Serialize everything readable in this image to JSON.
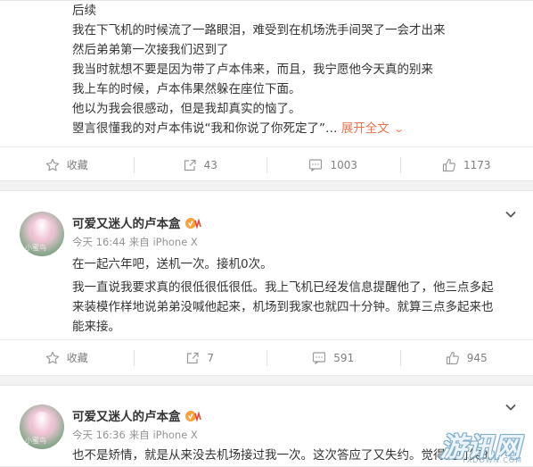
{
  "posts": [
    {
      "lines": [
        "后续",
        "我在下飞机的时候流了一路眼泪，难受到在机场洗手间哭了一会才出来",
        "然后弟弟第一次接我们迟到了",
        "我当时就想不要是因为带了卢本伟来，而且，我宁愿他今天真的别来",
        "我上车的时候，卢本伟果然躲在座位下面。",
        "他以为我会很感动，但是我却真实的恼了。",
        "曌言很懂我的对卢本伟说“我和你说了你死定了”…"
      ],
      "expand_label": "展开全文",
      "actions": {
        "favorite": "收藏",
        "repost": "43",
        "comment": "1003",
        "like": "1173"
      }
    },
    {
      "username": "可爱又迷人的卢本盒",
      "time": "今天 16:44",
      "source": "来自 iPhone X",
      "lines": [
        "在一起六年吧，送机一次。接机0次。",
        "我一直说我要求真的很低很低很低。我上飞机已经发信息提醒他了，他三点多起",
        "来装模作样地说弟弟没喊他起来，机场到我家也就四十分钟。就算三点多起来也",
        "能来接。"
      ],
      "actions": {
        "favorite": "收藏",
        "repost": "7",
        "comment": "591",
        "like": "945"
      }
    },
    {
      "username": "可爱又迷人的卢本盒",
      "time": "今天 16:36",
      "source": "来自 iPhone X",
      "lines": [
        "也不是矫情，就是从来没去机场接过我一次。这次答应了又失约。觉得挺可笑的"
      ]
    }
  ],
  "avatar_watermark": "小蜜鸟",
  "watermark": {
    "main": "游讯网",
    "sub": "YXDOWN.COM"
  },
  "colors": {
    "accent": "#eb7350",
    "meta_text": "#939393",
    "action_text": "#808080",
    "background": "#f2f2f2"
  },
  "icons": [
    "favorite-icon",
    "repost-icon",
    "comment-icon",
    "like-icon",
    "chevron-down-icon",
    "vip-icon"
  ]
}
